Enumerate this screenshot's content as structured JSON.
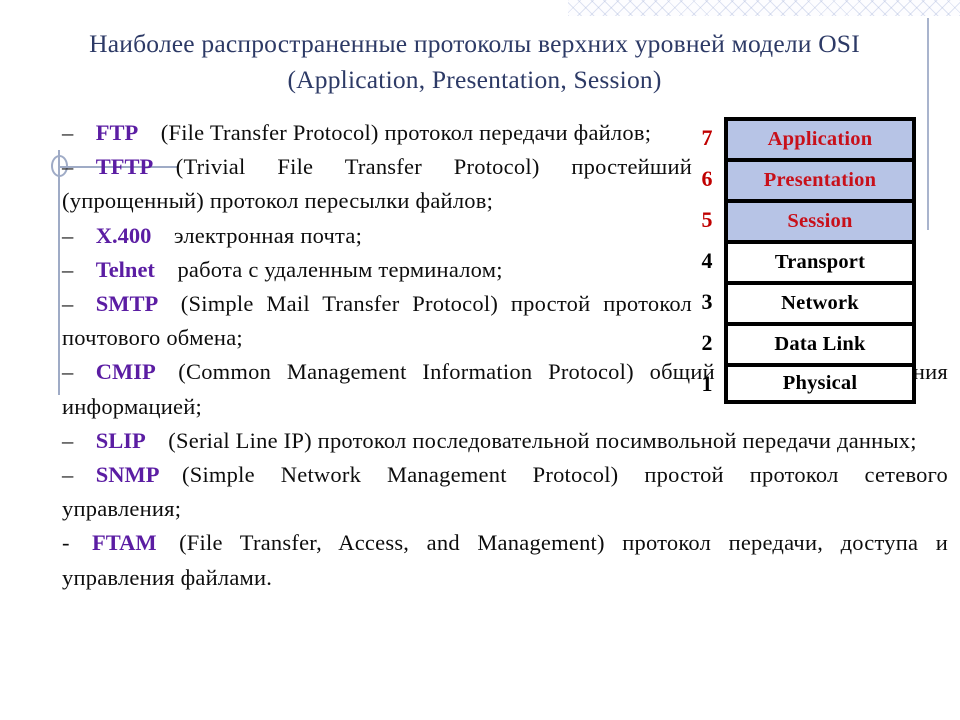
{
  "slide": {
    "title_line_1": "Наиболее распространенные протоколы  верхних уровней модели OSI",
    "title_line_2": "(Application, Presentation, Session)",
    "title_color": "#2d3a66",
    "protocol_name_color": "#5b1da3",
    "upper_layer_fill": "#b7c4e6",
    "upper_layer_text_color": "#c8101a"
  },
  "content": {
    "items": [
      {
        "dash": "–",
        "name": "FTP",
        "rest": "(File Transfer Protocol) протокол передачи файлов;",
        "width": "narrow"
      },
      {
        "dash": "–",
        "name": "TFTP",
        "rest": "(Trivial File Transfer Protocol) простейший (упрощенный) протокол пересылки файлов;",
        "width": "narrow"
      },
      {
        "dash": "–",
        "name": "X.400",
        "rest": "электронная почта;",
        "width": "narrow"
      },
      {
        "dash": "–",
        "name": "Telnet",
        "rest": "работа с удаленным терминалом;",
        "width": "narrow"
      },
      {
        "dash": "–",
        "name": "SMTP",
        "rest": "(Simple Mail Transfer Protocol) простой протокол почтового обмена;",
        "width": "narrow"
      },
      {
        "dash": "–",
        "name": "CMIP",
        "rest": "(Common Management Information Protocol) общий протокол управления информацией;",
        "width": "wide"
      },
      {
        "dash": "–",
        "name": "SLIP",
        "rest": "(Serial Line IP) протокол последовательной посимвольной передачи данных;",
        "width": "wide"
      },
      {
        "dash": "–",
        "name": "SNMP",
        "rest": "(Simple Network Management Protocol) простой протокол сетевого управления;",
        "width": "wide"
      },
      {
        "dash": "-",
        "name": "FTAM",
        "rest": "(File Transfer, Access, and Management) протокол передачи, доступа и управления файлами.",
        "width": "wide"
      }
    ]
  },
  "osi_model": {
    "layers": [
      {
        "number": "7",
        "name": "Application",
        "highlighted": true
      },
      {
        "number": "6",
        "name": "Presentation",
        "highlighted": true
      },
      {
        "number": "5",
        "name": "Session",
        "highlighted": true
      },
      {
        "number": "4",
        "name": "Transport",
        "highlighted": false
      },
      {
        "number": "3",
        "name": "Network",
        "highlighted": false
      },
      {
        "number": "2",
        "name": "Data Link",
        "highlighted": false
      },
      {
        "number": "1",
        "name": "Physical",
        "highlighted": false
      }
    ]
  }
}
